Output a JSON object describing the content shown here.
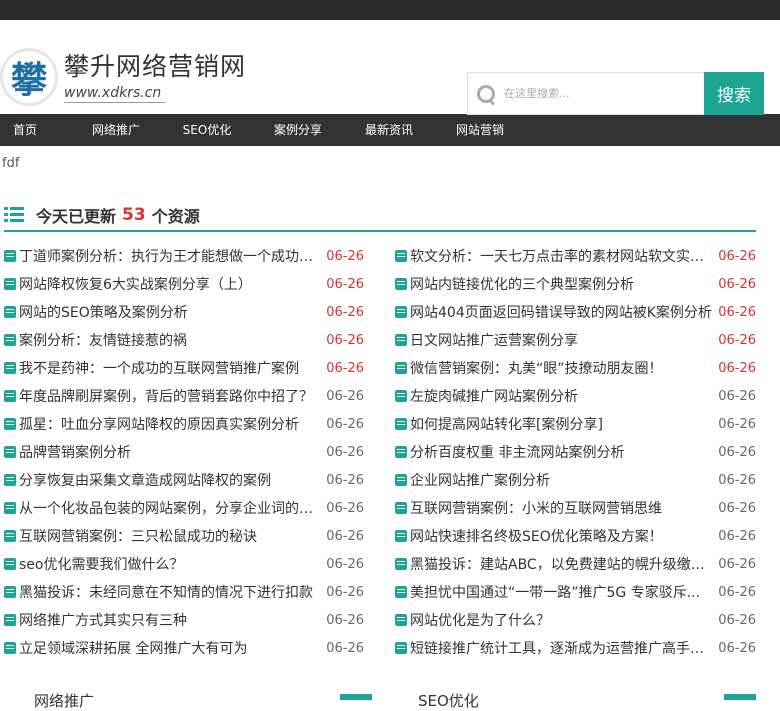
{
  "site": {
    "logo_char": "攀",
    "title": "攀升网络营销网",
    "url": "www.xdkrs.cn"
  },
  "search": {
    "placeholder": "在这里搜索...",
    "button": "搜索"
  },
  "nav": [
    "首页",
    "网络推广",
    "SEO优化",
    "案例分享",
    "最新资讯",
    "网站营销"
  ],
  "custom_text": "fdf",
  "update": {
    "prefix": "今天已更新",
    "count": "53",
    "suffix": "个资源"
  },
  "colors": {
    "accent": "#1ca593",
    "highlight_date": "#d33333",
    "normal_date": "#666666",
    "topbar": "#2b2b2b",
    "nav_bg": "#333333"
  },
  "articles_left": [
    {
      "title": "丁道师案例分析：执行为王才能想做一个成功的...",
      "date": "06-26",
      "highlight": true
    },
    {
      "title": "网站降权恢复6大实战案例分享（上）",
      "date": "06-26",
      "highlight": true
    },
    {
      "title": "网站的SEO策略及案例分析",
      "date": "06-26",
      "highlight": true
    },
    {
      "title": "案例分析：友情链接惹的祸",
      "date": "06-26",
      "highlight": true
    },
    {
      "title": "我不是药神：一个成功的互联网营销推广案例",
      "date": "06-26",
      "highlight": true
    },
    {
      "title": "年度品牌刷屏案例，背后的营销套路你中招了？",
      "date": "06-26",
      "highlight": false
    },
    {
      "title": "孤星：吐血分享网站降权的原因真实案例分析",
      "date": "06-26",
      "highlight": false
    },
    {
      "title": "品牌营销案例分析",
      "date": "06-26",
      "highlight": false
    },
    {
      "title": "分享恢复由采集文章造成网站降权的案例",
      "date": "06-26",
      "highlight": false
    },
    {
      "title": "从一个化妆品包装的网站案例，分享企业词的优...",
      "date": "06-26",
      "highlight": false
    },
    {
      "title": "互联网营销案例：三只松鼠成功的秘诀",
      "date": "06-26",
      "highlight": false
    },
    {
      "title": "seo优化需要我们做什么？",
      "date": "06-26",
      "highlight": false
    },
    {
      "title": "黑猫投诉：未经同意在不知情的情况下进行扣款",
      "date": "06-26",
      "highlight": false
    },
    {
      "title": "网络推广方式其实只有三种",
      "date": "06-26",
      "highlight": false
    },
    {
      "title": "立足领域深耕拓展 全网推广大有可为",
      "date": "06-26",
      "highlight": false
    }
  ],
  "articles_right": [
    {
      "title": "软文分析：一天七万点击率的素材网站软文实战...",
      "date": "06-26",
      "highlight": true
    },
    {
      "title": "网站内链接优化的三个典型案例分析",
      "date": "06-26",
      "highlight": true
    },
    {
      "title": "网站404页面返回码错误导致的网站被K案例分析",
      "date": "06-26",
      "highlight": true
    },
    {
      "title": "日文网站推广运营案例分享",
      "date": "06-26",
      "highlight": true
    },
    {
      "title": "微信营销案例：丸美“眼”技撩动朋友圈！",
      "date": "06-26",
      "highlight": true
    },
    {
      "title": "左旋肉碱推广网站案例分析",
      "date": "06-26",
      "highlight": false
    },
    {
      "title": "如何提高网站转化率[案例分享]",
      "date": "06-26",
      "highlight": false
    },
    {
      "title": "分析百度权重 非主流网站案例分析",
      "date": "06-26",
      "highlight": false
    },
    {
      "title": "企业网站推广案例分析",
      "date": "06-26",
      "highlight": false
    },
    {
      "title": "互联网营销案例：小米的互联网营销思维",
      "date": "06-26",
      "highlight": false
    },
    {
      "title": "网站快速排名终极SEO优化策略及方案！",
      "date": "06-26",
      "highlight": false
    },
    {
      "title": "黑猫投诉：建站ABC，以免费建站的幌升级缴费...",
      "date": "06-26",
      "highlight": false
    },
    {
      "title": "美担忧中国通过“一带一路”推广5G 专家驳斥...",
      "date": "06-26",
      "highlight": false
    },
    {
      "title": "网站优化是为了什么？",
      "date": "06-26",
      "highlight": false
    },
    {
      "title": "短链接推广统计工具，逐渐成为运营推广高手新宠",
      "date": "06-26",
      "highlight": false
    }
  ],
  "bottom_sections": [
    "网络推广",
    "SEO优化"
  ]
}
